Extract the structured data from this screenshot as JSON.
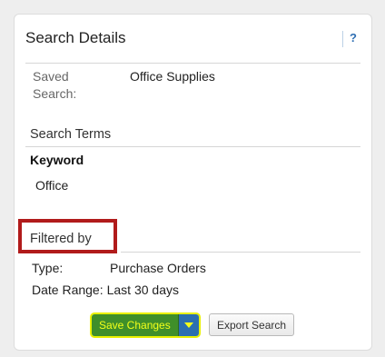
{
  "panel": {
    "title": "Search Details",
    "help_label": "?",
    "saved_search": {
      "label": "Saved Search:",
      "value": "Office Supplies"
    },
    "search_terms": {
      "title": "Search Terms",
      "keyword_label": "Keyword",
      "keyword_value": "Office"
    },
    "filtered_by": {
      "title": "Filtered by",
      "type_label": "Type:",
      "type_value": "Purchase Orders",
      "date_range_label": "Date Range:",
      "date_range_value": "Last 30 days"
    },
    "buttons": {
      "save_label": "Save Changes",
      "export_label": "Export Search"
    }
  },
  "colors": {
    "highlight_box": "#b11b1b",
    "save_button": "#3f8f2a",
    "save_text": "#f2ff1a",
    "dropdown_button": "#2b6fb0",
    "help_link": "#2f6fb3"
  },
  "icons": {
    "dropdown": "caret-down-icon"
  }
}
